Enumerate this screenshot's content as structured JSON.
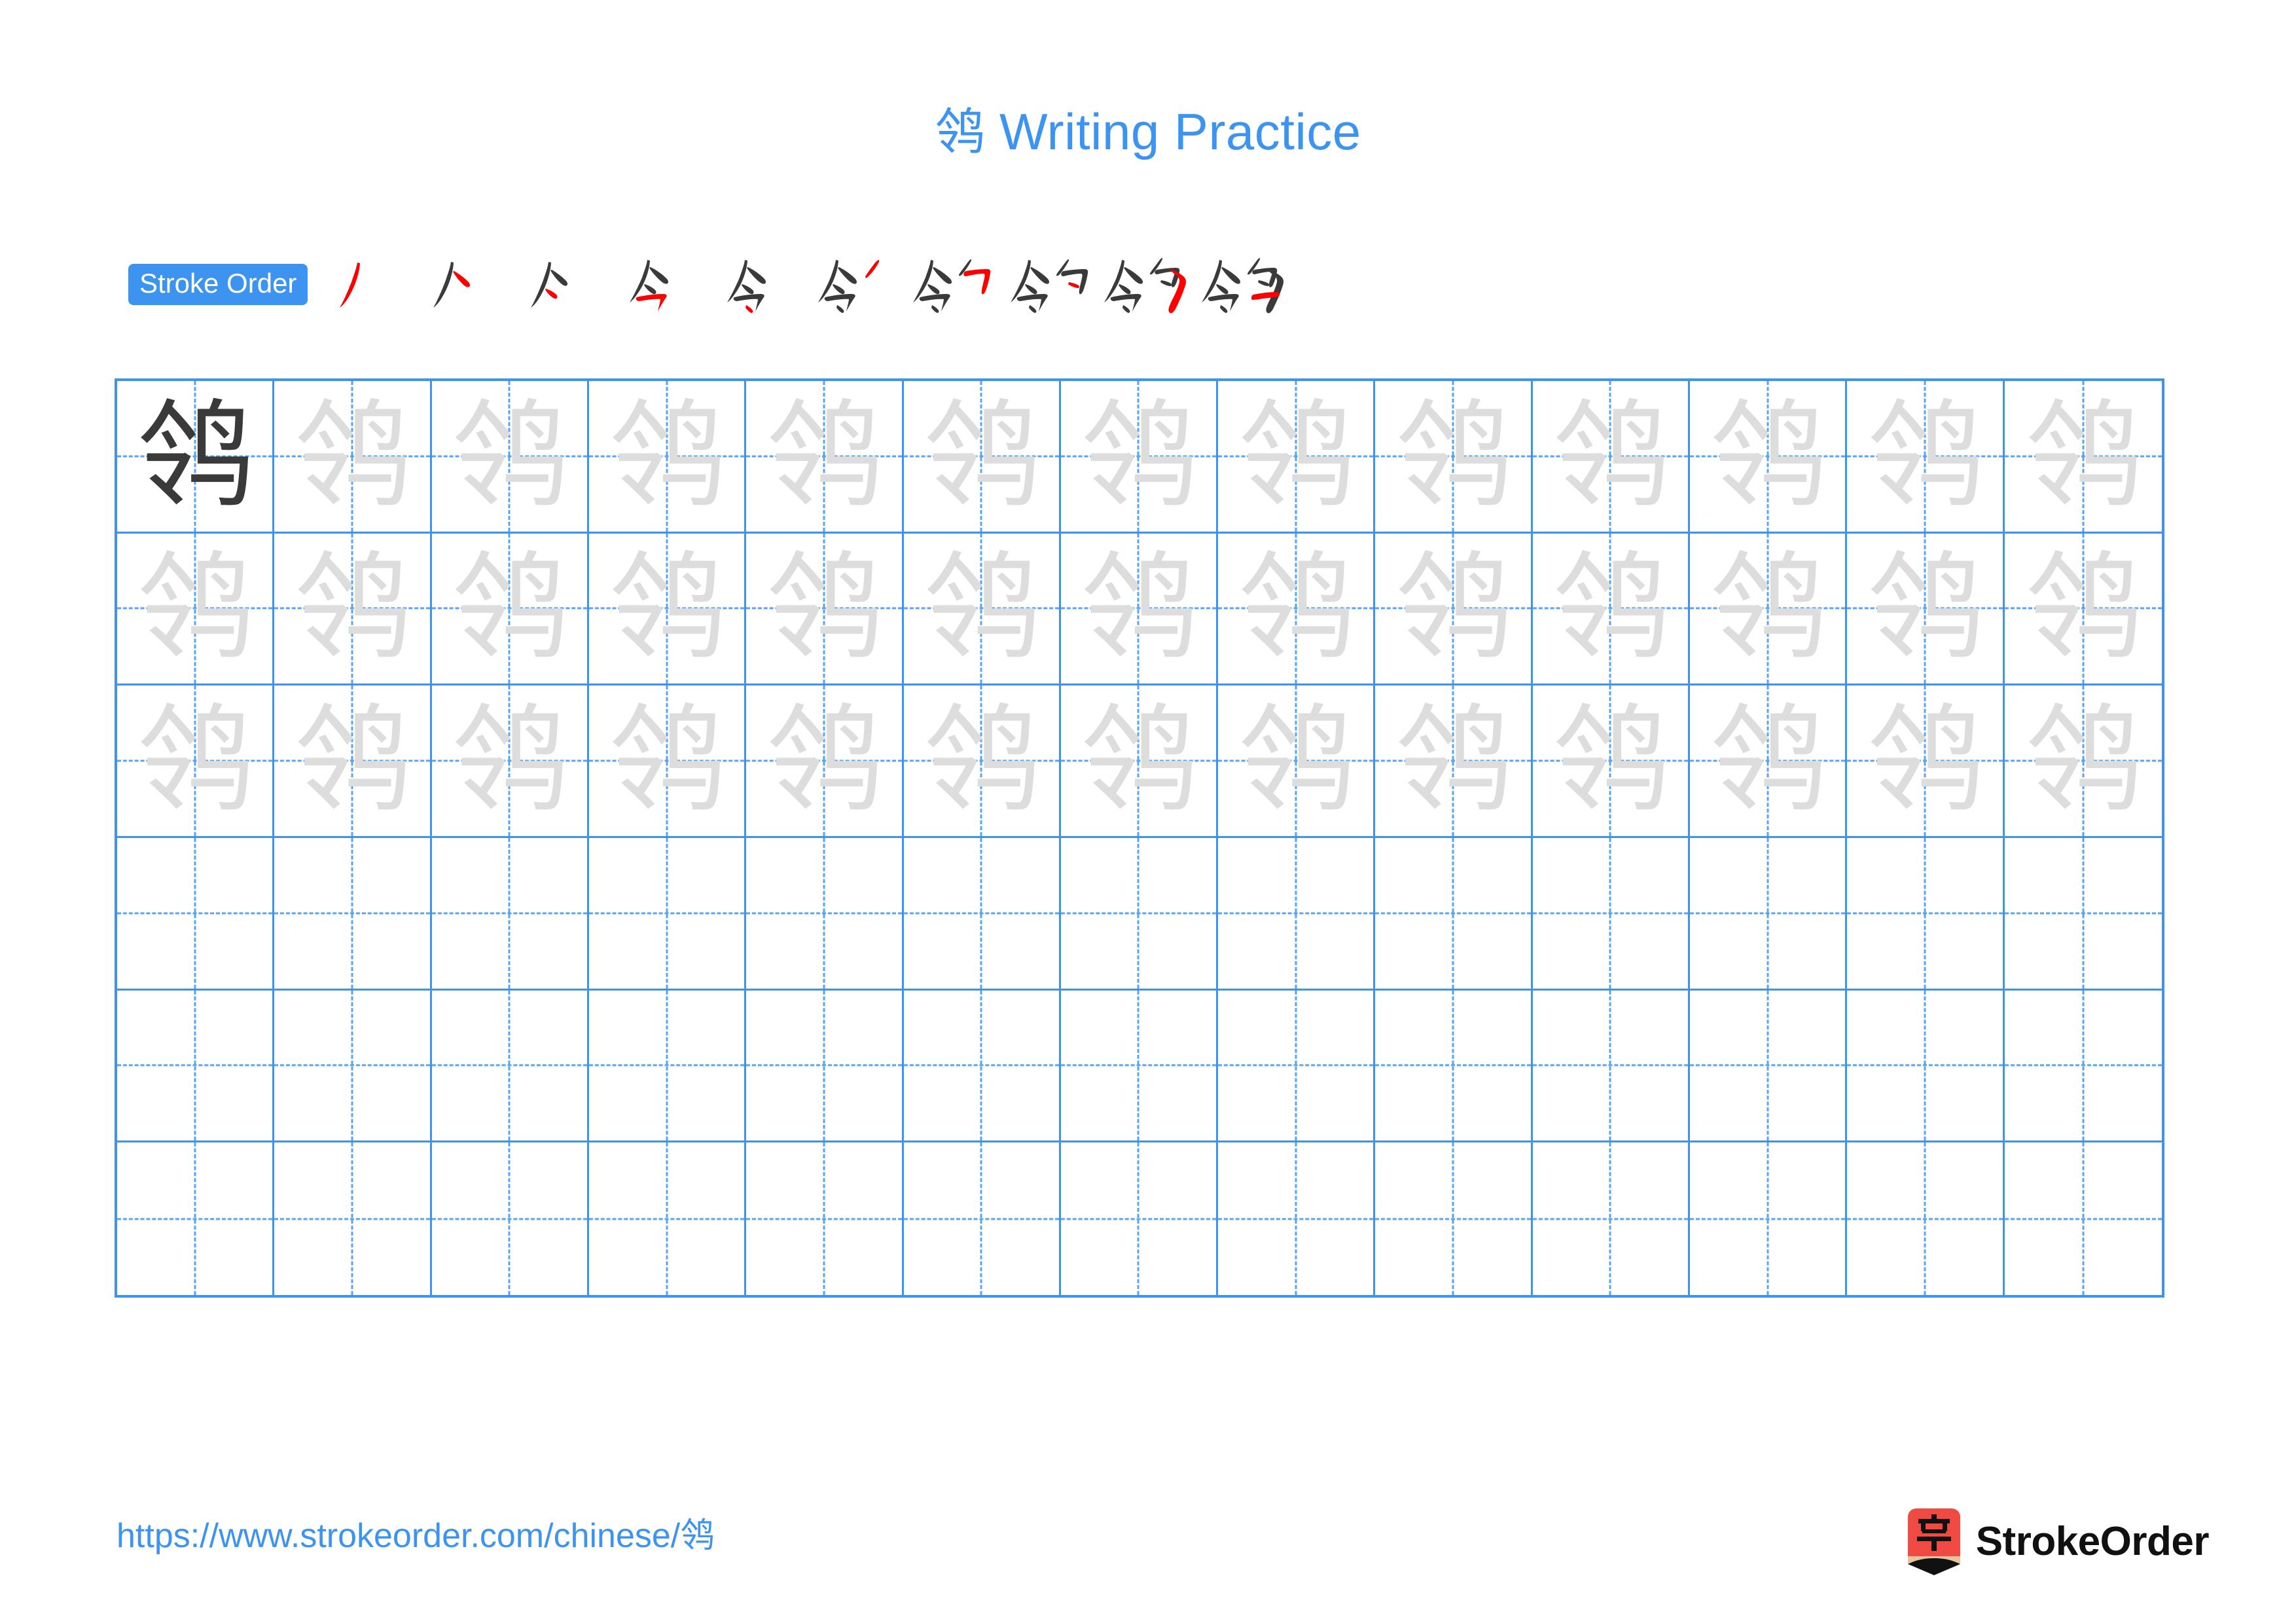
{
  "page": {
    "character": "鸰",
    "background_color": "#ffffff",
    "accent_color": "#3d94f0",
    "grid_line_color": "#3d94f0",
    "guide_line_color": "#57a4f5",
    "trace_char_color": "#dddddd",
    "model_char_color": "#3a3a3a",
    "stroke_new_color": "#ff0000",
    "stroke_old_color": "#3a3a3a"
  },
  "title": {
    "character": "鸰",
    "text": " Writing Practice",
    "full": "鸰 Writing Practice"
  },
  "stroke_order": {
    "label": "Stroke Order",
    "total_strokes": 10,
    "steps": [
      {
        "index": 1,
        "partial": "丿"
      },
      {
        "index": 2,
        "partial": "人"
      },
      {
        "index": 3,
        "partial": "亽"
      },
      {
        "index": 4,
        "partial": "今"
      },
      {
        "index": 5,
        "partial": "令"
      },
      {
        "index": 6,
        "partial": "令丿"
      },
      {
        "index": 7,
        "partial": "令勹"
      },
      {
        "index": 8,
        "partial": "令勺"
      },
      {
        "index": 9,
        "partial": "鸰"
      },
      {
        "index": 10,
        "partial": "鸰"
      }
    ]
  },
  "practice_grid": {
    "columns": 13,
    "rows": 6,
    "cells": [
      [
        "model",
        "trace",
        "trace",
        "trace",
        "trace",
        "trace",
        "trace",
        "trace",
        "trace",
        "trace",
        "trace",
        "trace",
        "trace"
      ],
      [
        "trace",
        "trace",
        "trace",
        "trace",
        "trace",
        "trace",
        "trace",
        "trace",
        "trace",
        "trace",
        "trace",
        "trace",
        "trace"
      ],
      [
        "trace",
        "trace",
        "trace",
        "trace",
        "trace",
        "trace",
        "trace",
        "trace",
        "trace",
        "trace",
        "trace",
        "trace",
        "trace"
      ],
      [
        "empty",
        "empty",
        "empty",
        "empty",
        "empty",
        "empty",
        "empty",
        "empty",
        "empty",
        "empty",
        "empty",
        "empty",
        "empty"
      ],
      [
        "empty",
        "empty",
        "empty",
        "empty",
        "empty",
        "empty",
        "empty",
        "empty",
        "empty",
        "empty",
        "empty",
        "empty",
        "empty"
      ],
      [
        "empty",
        "empty",
        "empty",
        "empty",
        "empty",
        "empty",
        "empty",
        "empty",
        "empty",
        "empty",
        "empty",
        "empty",
        "empty"
      ]
    ]
  },
  "footer": {
    "url_prefix": "https://www.strokeorder.com/chinese/",
    "url_character": "鸰",
    "url_full": "https://www.strokeorder.com/chinese/鸰",
    "brand_name": "StrokeOrder",
    "brand_mark_character": "字",
    "brand_mark_color": "#f04a42",
    "brand_mark_tip_color": "#e8c49a"
  }
}
